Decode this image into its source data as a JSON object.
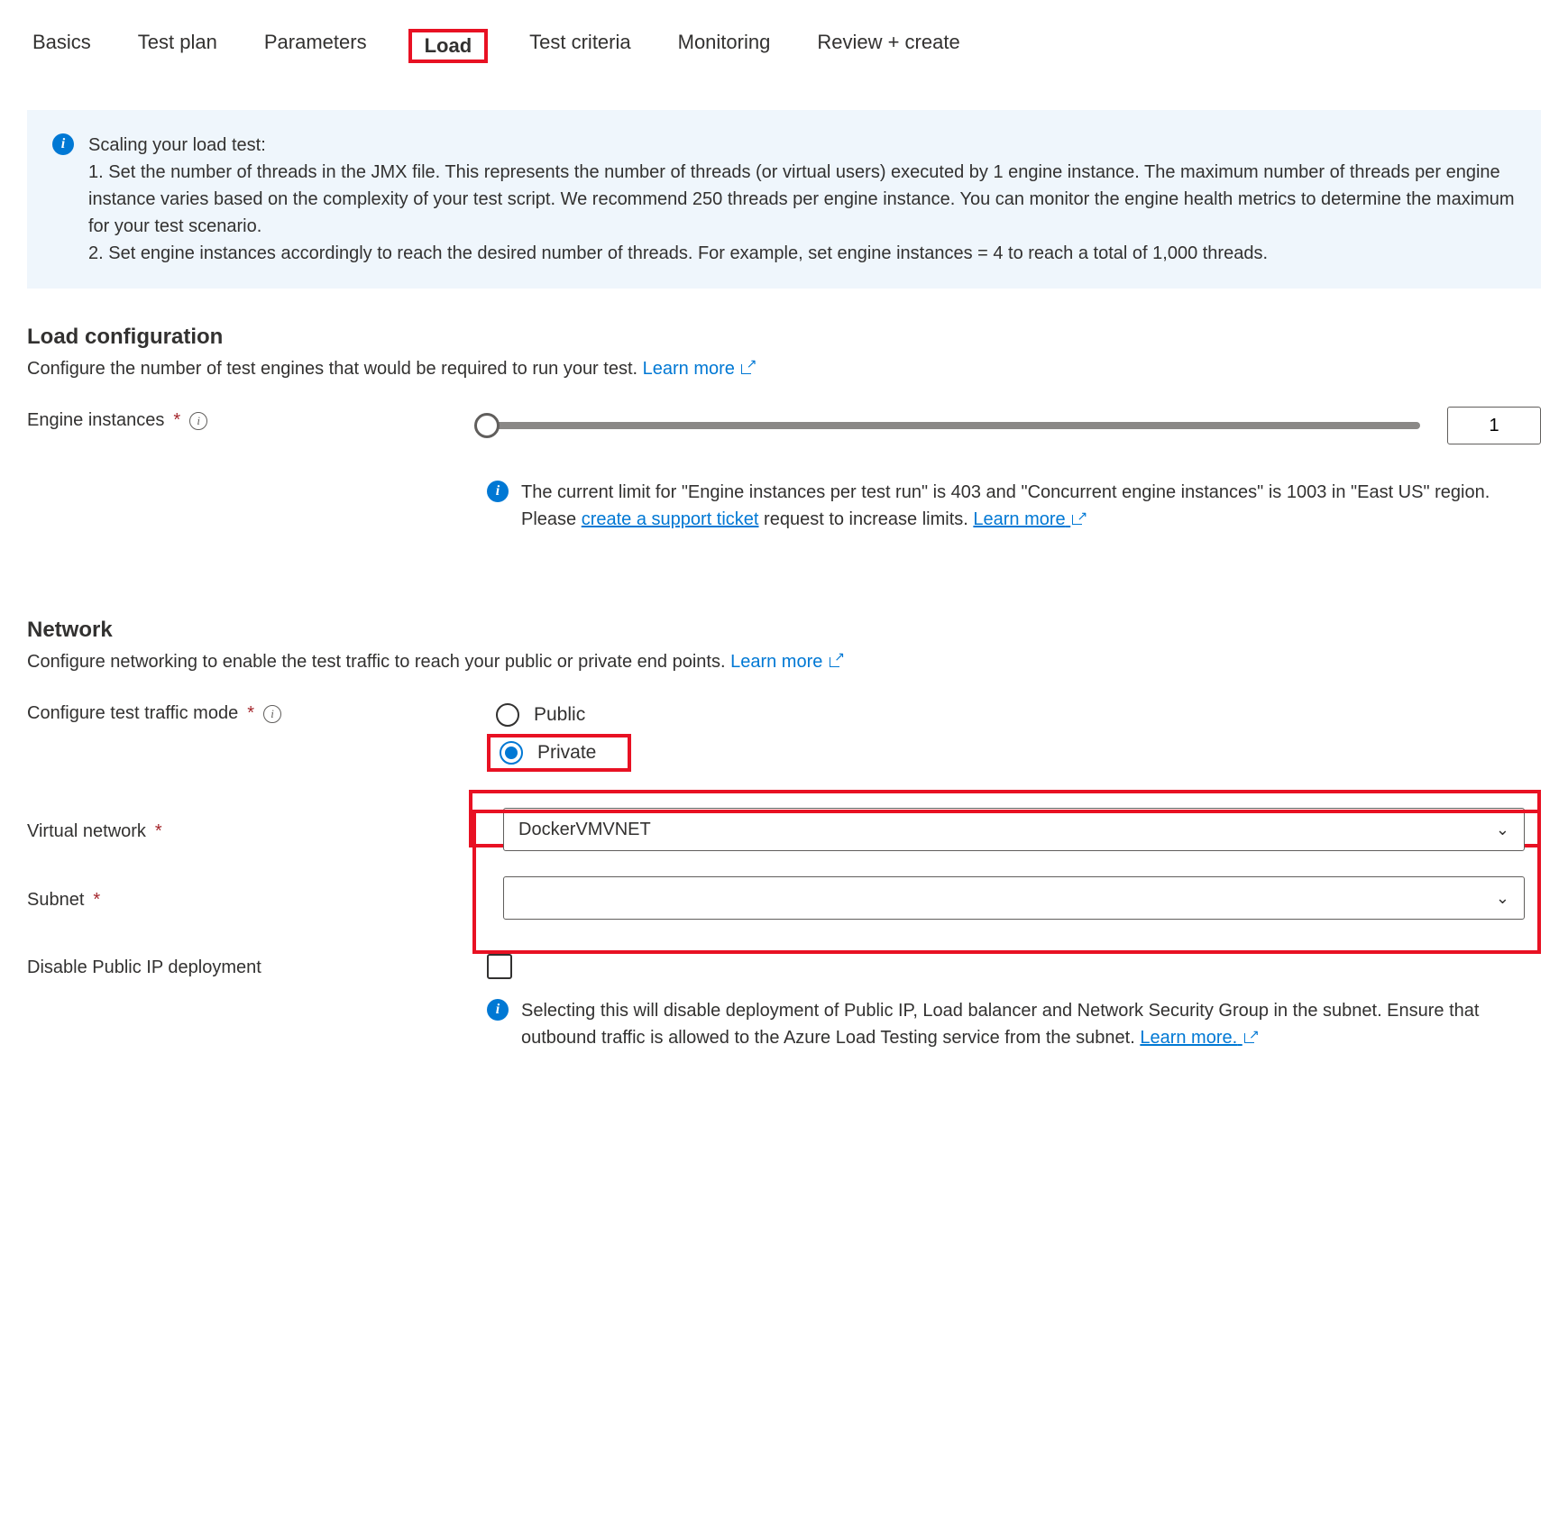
{
  "tabs": [
    "Basics",
    "Test plan",
    "Parameters",
    "Load",
    "Test criteria",
    "Monitoring",
    "Review + create"
  ],
  "activeTab": "Load",
  "scalingInfo": "Scaling your load test:\n1. Set the number of threads in the JMX file. This represents the number of threads (or virtual users) executed by 1 engine instance. The maximum number of threads per engine instance varies based on the complexity of your test script. We recommend 250 threads per engine instance. You can monitor the engine health metrics to determine the maximum for your test scenario.\n2. Set engine instances accordingly to reach the desired number of threads. For example, set engine instances = 4 to reach a total of 1,000 threads.",
  "loadConfig": {
    "title": "Load configuration",
    "subtitle": "Configure the number of test engines that would be required to run your test. ",
    "learnMore": "Learn more",
    "engineLabel": "Engine instances",
    "engineValue": "1",
    "limitNote1": "The current limit for \"Engine instances per test run\" is 403 and \"Concurrent engine instances\" is 1003 in \"East US\" region. Please ",
    "limitLink1": "create a support ticket",
    "limitNote2": " request to increase limits. ",
    "limitLink2": "Learn more"
  },
  "network": {
    "title": "Network",
    "subtitle": "Configure networking to enable the test traffic to reach your public or private end points. ",
    "learnMore": "Learn more",
    "trafficModeLabel": "Configure test traffic mode",
    "optPublic": "Public",
    "optPrivate": "Private",
    "vnetLabel": "Virtual network",
    "vnetValue": "DockerVMVNET",
    "subnetLabel": "Subnet",
    "subnetValue": "",
    "disablePipLabel": "Disable Public IP deployment",
    "pipNote": "Selecting this will disable deployment of Public IP, Load balancer and Network Security Group in the subnet. Ensure that outbound traffic is allowed to the Azure Load Testing service from the subnet. ",
    "pipLink": "Learn more."
  }
}
